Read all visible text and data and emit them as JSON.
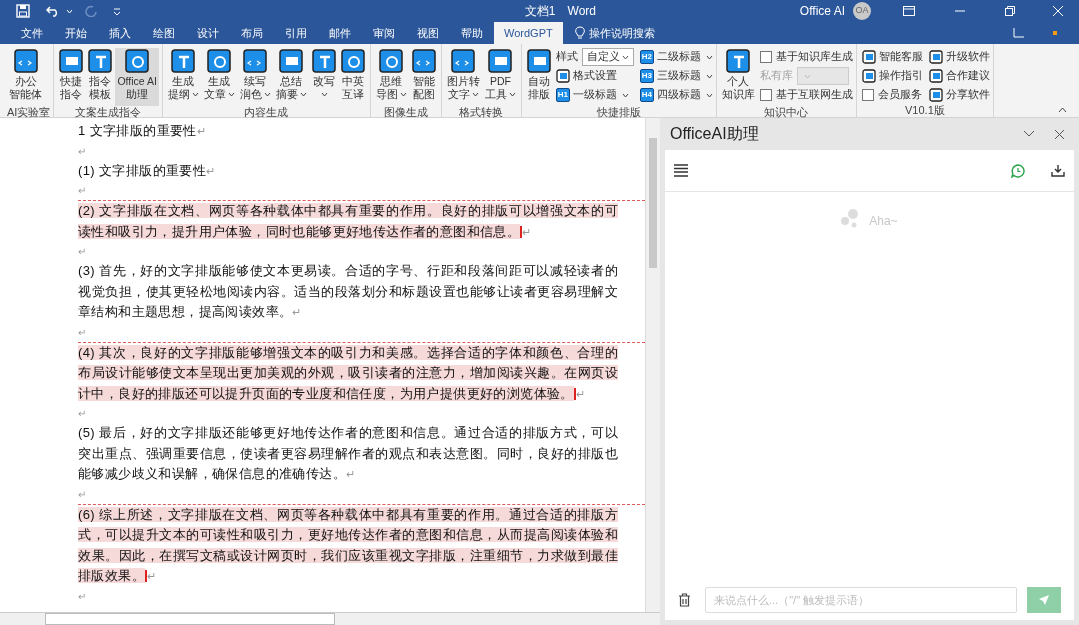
{
  "title_bar": {
    "document_title": "文档1",
    "app_name": "Word",
    "account": "Office AI",
    "avatar": "OA",
    "redo_disabled": true
  },
  "tabs": [
    {
      "label": "文件",
      "selected": false
    },
    {
      "label": "开始",
      "selected": false
    },
    {
      "label": "插入",
      "selected": false
    },
    {
      "label": "绘图",
      "selected": false
    },
    {
      "label": "设计",
      "selected": false
    },
    {
      "label": "布局",
      "selected": false
    },
    {
      "label": "引用",
      "selected": false
    },
    {
      "label": "邮件",
      "selected": false
    },
    {
      "label": "审阅",
      "selected": false
    },
    {
      "label": "视图",
      "selected": false
    },
    {
      "label": "帮助",
      "selected": false
    },
    {
      "label": "WordGPT",
      "selected": true
    }
  ],
  "tell_me": "操作说明搜索",
  "ribbon_groups": [
    {
      "label": "AI实验室",
      "large": [
        {
          "lines": [
            "办公",
            "智能体"
          ],
          "has_menu": false,
          "hovered": false
        }
      ]
    },
    {
      "label": "文案生成指令",
      "large": [
        {
          "lines": [
            "快捷",
            "指令"
          ],
          "has_menu": false,
          "hovered": false
        },
        {
          "lines": [
            "指令",
            "模板"
          ],
          "has_menu": false,
          "hovered": false
        },
        {
          "lines": [
            "Office AI",
            "助理"
          ],
          "has_menu": false,
          "hovered": true
        }
      ]
    },
    {
      "label": "内容生成",
      "large": [
        {
          "lines": [
            "生成",
            "提纲"
          ],
          "has_menu": true,
          "hovered": false
        },
        {
          "lines": [
            "生成",
            "文章"
          ],
          "has_menu": true,
          "hovered": false
        },
        {
          "lines": [
            "续写",
            "润色"
          ],
          "has_menu": true,
          "hovered": false
        },
        {
          "lines": [
            "总结",
            "摘要"
          ],
          "has_menu": true,
          "hovered": false
        },
        {
          "lines": [
            "改写"
          ],
          "has_menu": true,
          "hovered": false
        },
        {
          "lines": [
            "中英",
            "互译"
          ],
          "has_menu": false,
          "hovered": false
        }
      ]
    },
    {
      "label": "图像生成",
      "large": [
        {
          "lines": [
            "思维",
            "导图"
          ],
          "has_menu": true,
          "hovered": false
        },
        {
          "lines": [
            "智能",
            "配图"
          ],
          "has_menu": false,
          "hovered": false
        }
      ]
    },
    {
      "label": "格式转换",
      "large": [
        {
          "lines": [
            "图片转",
            "文字"
          ],
          "has_menu": true,
          "hovered": false
        },
        {
          "lines": [
            "PDF",
            "工具"
          ],
          "has_menu": true,
          "hovered": false
        }
      ]
    },
    {
      "label": "快捷排版",
      "large": [
        {
          "lines": [
            "自动",
            "排版"
          ],
          "has_menu": false,
          "hovered": false
        }
      ],
      "small": [
        {
          "kind": "select",
          "label": "样式",
          "value": "自定义",
          "disabled": false
        },
        {
          "kind": "button",
          "label": "格式设置",
          "has_menu": false
        },
        {
          "kind": "button",
          "label": "一级标题",
          "badge": "H1",
          "has_menu": true
        },
        {
          "kind": "button",
          "label": "二级标题",
          "badge": "H2",
          "has_menu": true
        },
        {
          "kind": "button",
          "label": "三级标题",
          "badge": "H3",
          "has_menu": true
        },
        {
          "kind": "button",
          "label": "四级标题",
          "badge": "H4",
          "has_menu": true
        }
      ]
    },
    {
      "label": "知识中心",
      "large": [
        {
          "lines": [
            "个人",
            "知识库"
          ],
          "has_menu": false,
          "hovered": false
        }
      ],
      "small": [
        {
          "kind": "checkbox",
          "label": "基于知识库生成",
          "checked": false
        },
        {
          "kind": "select",
          "label": "私有库",
          "disabled": true
        },
        {
          "kind": "checkbox",
          "label": "基于互联网生成",
          "checked": false
        }
      ]
    },
    {
      "label": "V10.1版",
      "small": [
        {
          "kind": "button",
          "label": "智能客服",
          "has_menu": false
        },
        {
          "kind": "button",
          "label": "操作指引",
          "has_menu": false
        },
        {
          "kind": "checkbox",
          "label": "会员服务",
          "checked": false
        },
        {
          "kind": "button",
          "label": "升级软件",
          "has_menu": false
        },
        {
          "kind": "button",
          "label": "合作建议",
          "has_menu": false
        },
        {
          "kind": "button",
          "label": "分享软件",
          "has_menu": false
        }
      ]
    }
  ],
  "document": {
    "paragraphs": [
      {
        "kind": "heading",
        "number": "1",
        "text": "文字排版的重要性",
        "mark": "↵",
        "highlighted": false
      },
      {
        "kind": "empty",
        "mark": "↵"
      },
      {
        "kind": "text",
        "number": "(1)",
        "text": "文字排版的重要性",
        "mark": "↵",
        "highlighted": false
      },
      {
        "kind": "empty",
        "mark": "↵"
      },
      {
        "kind": "text",
        "number": "(2)",
        "text": "文字排版在文档、网页等各种载体中都具有重要的作用。良好的排版可以增强文本的可读性和吸引力，提升用户体验，同时也能够更好地传达作者的意图和信息。",
        "mark": "↵",
        "highlighted": true
      },
      {
        "kind": "empty",
        "mark": "↵"
      },
      {
        "kind": "text",
        "number": "(3)",
        "text": "首先，好的文字排版能够使文本更易读。合适的字号、行距和段落间距可以减轻读者的视觉负担，使其更轻松地阅读内容。适当的段落划分和标题设置也能够让读者更容易理解文章结构和主题思想，提高阅读效率。",
        "mark": "↵",
        "highlighted": false
      },
      {
        "kind": "empty",
        "mark": "↵"
      },
      {
        "kind": "text",
        "number": "(4)",
        "text": "其次，良好的文字排版能够增强文本的吸引力和美感。选择合适的字体和颜色、合理的布局设计能够使文本呈现出更加美观的外观，吸引读者的注意力，增加阅读兴趣。在网页设计中，良好的排版还可以提升页面的专业度和信任度，为用户提供更好的浏览体验。",
        "mark": "↵",
        "highlighted": true
      },
      {
        "kind": "empty",
        "mark": "↵"
      },
      {
        "kind": "text",
        "number": "(5)",
        "text": "最后，好的文字排版还能够更好地传达作者的意图和信息。通过合适的排版方式，可以突出重点、强调重要信息，使读者更容易理解作者的观点和表达意图。同时，良好的排版也能够减少歧义和误解，确保信息的准确传达。",
        "mark": "↵",
        "highlighted": false
      },
      {
        "kind": "empty",
        "mark": "↵"
      },
      {
        "kind": "text",
        "number": "(6)",
        "text": "综上所述，文字排版在文档、网页等各种载体中都具有重要的作用。通过合适的排版方式，可以提升文本的可读性和吸引力，更好地传达作者的意图和信息，从而提高阅读体验和效果。因此，在撰写文稿或设计网页时，我们应该重视文字排版，注重细节，力求做到最佳排版效果。",
        "mark": "↵",
        "highlighted": true
      },
      {
        "kind": "empty",
        "mark": "↵"
      }
    ]
  },
  "assistant_panel": {
    "title": "OfficeAI助理",
    "empty_text": "Aha~",
    "input": {
      "placeholder": "来说点什么...（\"/\" 触发提示语）"
    }
  }
}
